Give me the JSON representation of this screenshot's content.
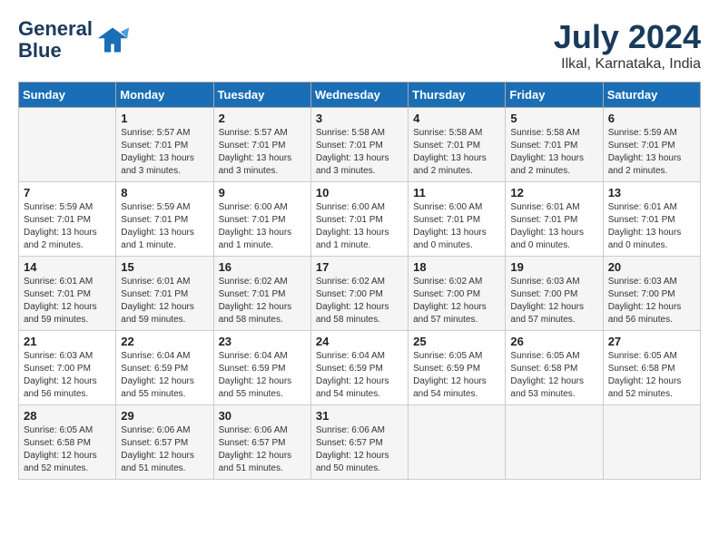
{
  "logo": {
    "line1": "General",
    "line2": "Blue"
  },
  "title": "July 2024",
  "subtitle": "Ilkal, Karnataka, India",
  "headers": [
    "Sunday",
    "Monday",
    "Tuesday",
    "Wednesday",
    "Thursday",
    "Friday",
    "Saturday"
  ],
  "weeks": [
    [
      {
        "day": "",
        "info": ""
      },
      {
        "day": "1",
        "info": "Sunrise: 5:57 AM\nSunset: 7:01 PM\nDaylight: 13 hours\nand 3 minutes."
      },
      {
        "day": "2",
        "info": "Sunrise: 5:57 AM\nSunset: 7:01 PM\nDaylight: 13 hours\nand 3 minutes."
      },
      {
        "day": "3",
        "info": "Sunrise: 5:58 AM\nSunset: 7:01 PM\nDaylight: 13 hours\nand 3 minutes."
      },
      {
        "day": "4",
        "info": "Sunrise: 5:58 AM\nSunset: 7:01 PM\nDaylight: 13 hours\nand 2 minutes."
      },
      {
        "day": "5",
        "info": "Sunrise: 5:58 AM\nSunset: 7:01 PM\nDaylight: 13 hours\nand 2 minutes."
      },
      {
        "day": "6",
        "info": "Sunrise: 5:59 AM\nSunset: 7:01 PM\nDaylight: 13 hours\nand 2 minutes."
      }
    ],
    [
      {
        "day": "7",
        "info": "Sunrise: 5:59 AM\nSunset: 7:01 PM\nDaylight: 13 hours\nand 2 minutes."
      },
      {
        "day": "8",
        "info": "Sunrise: 5:59 AM\nSunset: 7:01 PM\nDaylight: 13 hours\nand 1 minute."
      },
      {
        "day": "9",
        "info": "Sunrise: 6:00 AM\nSunset: 7:01 PM\nDaylight: 13 hours\nand 1 minute."
      },
      {
        "day": "10",
        "info": "Sunrise: 6:00 AM\nSunset: 7:01 PM\nDaylight: 13 hours\nand 1 minute."
      },
      {
        "day": "11",
        "info": "Sunrise: 6:00 AM\nSunset: 7:01 PM\nDaylight: 13 hours\nand 0 minutes."
      },
      {
        "day": "12",
        "info": "Sunrise: 6:01 AM\nSunset: 7:01 PM\nDaylight: 13 hours\nand 0 minutes."
      },
      {
        "day": "13",
        "info": "Sunrise: 6:01 AM\nSunset: 7:01 PM\nDaylight: 13 hours\nand 0 minutes."
      }
    ],
    [
      {
        "day": "14",
        "info": "Sunrise: 6:01 AM\nSunset: 7:01 PM\nDaylight: 12 hours\nand 59 minutes."
      },
      {
        "day": "15",
        "info": "Sunrise: 6:01 AM\nSunset: 7:01 PM\nDaylight: 12 hours\nand 59 minutes."
      },
      {
        "day": "16",
        "info": "Sunrise: 6:02 AM\nSunset: 7:01 PM\nDaylight: 12 hours\nand 58 minutes."
      },
      {
        "day": "17",
        "info": "Sunrise: 6:02 AM\nSunset: 7:00 PM\nDaylight: 12 hours\nand 58 minutes."
      },
      {
        "day": "18",
        "info": "Sunrise: 6:02 AM\nSunset: 7:00 PM\nDaylight: 12 hours\nand 57 minutes."
      },
      {
        "day": "19",
        "info": "Sunrise: 6:03 AM\nSunset: 7:00 PM\nDaylight: 12 hours\nand 57 minutes."
      },
      {
        "day": "20",
        "info": "Sunrise: 6:03 AM\nSunset: 7:00 PM\nDaylight: 12 hours\nand 56 minutes."
      }
    ],
    [
      {
        "day": "21",
        "info": "Sunrise: 6:03 AM\nSunset: 7:00 PM\nDaylight: 12 hours\nand 56 minutes."
      },
      {
        "day": "22",
        "info": "Sunrise: 6:04 AM\nSunset: 6:59 PM\nDaylight: 12 hours\nand 55 minutes."
      },
      {
        "day": "23",
        "info": "Sunrise: 6:04 AM\nSunset: 6:59 PM\nDaylight: 12 hours\nand 55 minutes."
      },
      {
        "day": "24",
        "info": "Sunrise: 6:04 AM\nSunset: 6:59 PM\nDaylight: 12 hours\nand 54 minutes."
      },
      {
        "day": "25",
        "info": "Sunrise: 6:05 AM\nSunset: 6:59 PM\nDaylight: 12 hours\nand 54 minutes."
      },
      {
        "day": "26",
        "info": "Sunrise: 6:05 AM\nSunset: 6:58 PM\nDaylight: 12 hours\nand 53 minutes."
      },
      {
        "day": "27",
        "info": "Sunrise: 6:05 AM\nSunset: 6:58 PM\nDaylight: 12 hours\nand 52 minutes."
      }
    ],
    [
      {
        "day": "28",
        "info": "Sunrise: 6:05 AM\nSunset: 6:58 PM\nDaylight: 12 hours\nand 52 minutes."
      },
      {
        "day": "29",
        "info": "Sunrise: 6:06 AM\nSunset: 6:57 PM\nDaylight: 12 hours\nand 51 minutes."
      },
      {
        "day": "30",
        "info": "Sunrise: 6:06 AM\nSunset: 6:57 PM\nDaylight: 12 hours\nand 51 minutes."
      },
      {
        "day": "31",
        "info": "Sunrise: 6:06 AM\nSunset: 6:57 PM\nDaylight: 12 hours\nand 50 minutes."
      },
      {
        "day": "",
        "info": ""
      },
      {
        "day": "",
        "info": ""
      },
      {
        "day": "",
        "info": ""
      }
    ]
  ]
}
